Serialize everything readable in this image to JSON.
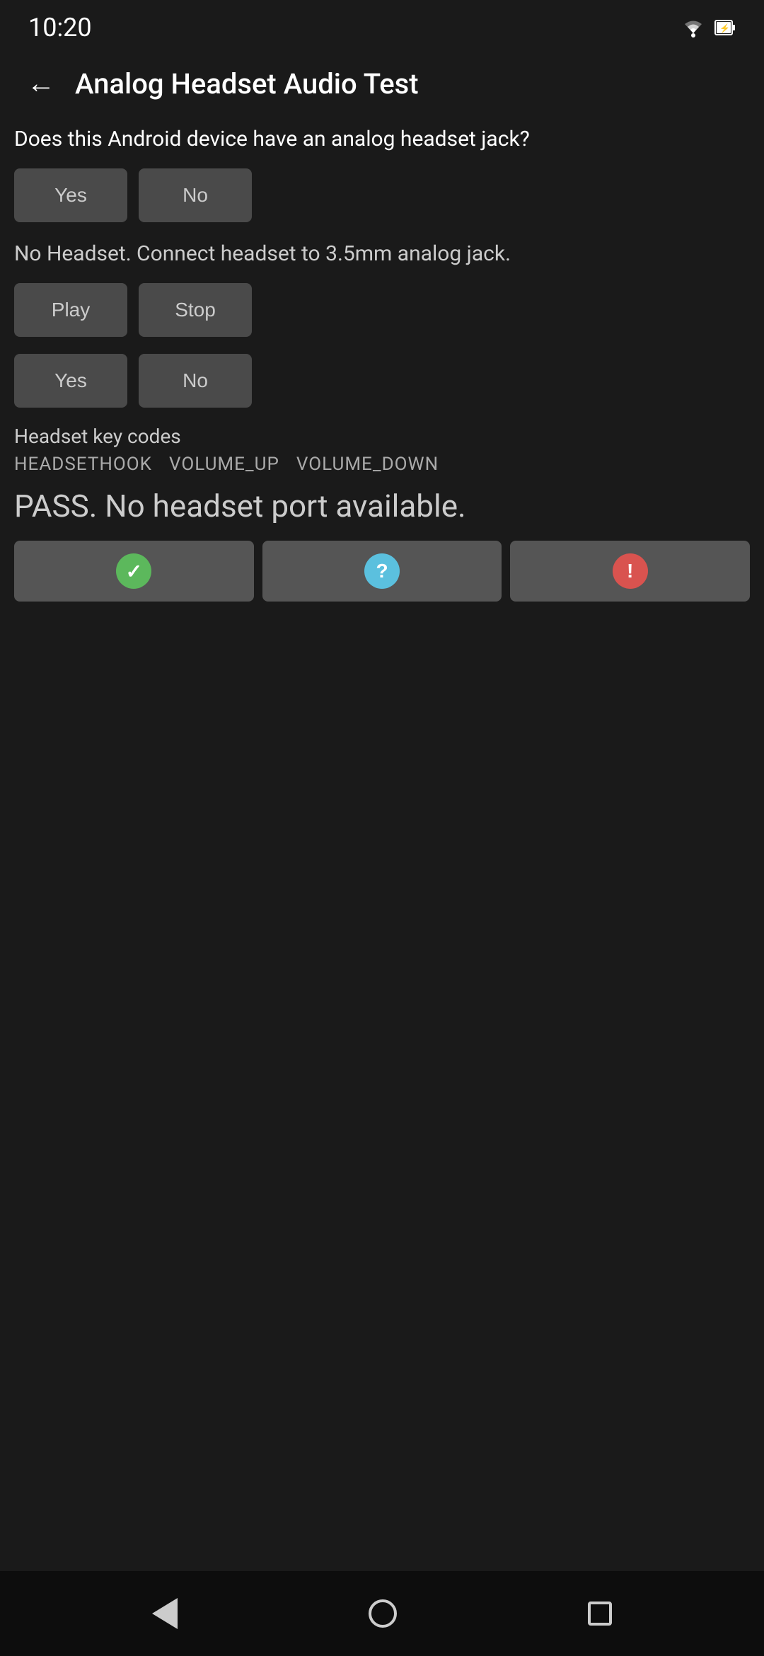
{
  "statusBar": {
    "time": "10:20"
  },
  "header": {
    "backLabel": "←",
    "title": "Analog Headset Audio Test"
  },
  "section1": {
    "question": "Does this Android device have an analog headset jack?",
    "yesLabel": "Yes",
    "noLabel": "No"
  },
  "section2": {
    "instruction": "No Headset. Connect headset to 3.5mm analog jack.",
    "playLabel": "Play",
    "stopLabel": "Stop",
    "yesLabel": "Yes",
    "noLabel": "No"
  },
  "keyCodes": {
    "title": "Headset key codes",
    "codes": [
      "HEADSETHOOK",
      "VOLUME_UP",
      "VOLUME_DOWN"
    ]
  },
  "passText": "PASS. No headset port available.",
  "resultButtons": {
    "passIcon": "✓",
    "questionIcon": "?",
    "failIcon": "!"
  }
}
